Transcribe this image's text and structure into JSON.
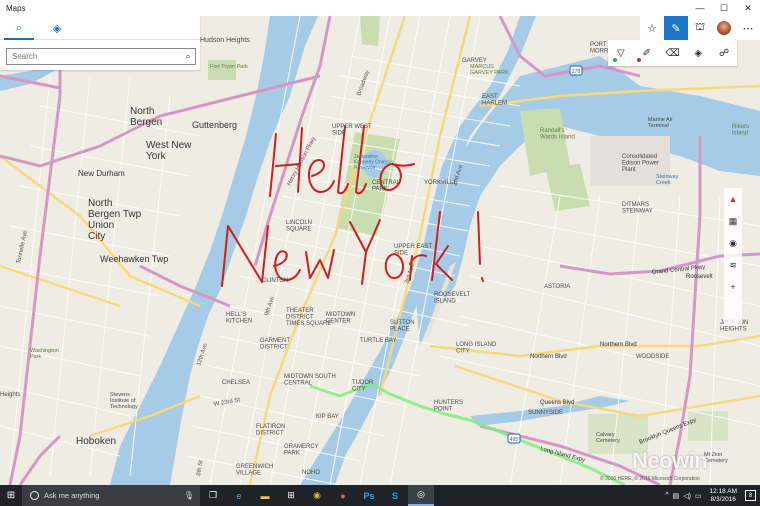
{
  "window": {
    "title": "Maps",
    "controls": [
      "—",
      "☐",
      "✕"
    ]
  },
  "panel": {
    "tabs": [
      {
        "icon": "search-icon",
        "glyph": "⌕"
      },
      {
        "icon": "directions-icon",
        "glyph": "◈"
      }
    ],
    "search_placeholder": "Search"
  },
  "toolbar": {
    "buttons": [
      {
        "name": "favorites-star-icon",
        "glyph": "☆"
      },
      {
        "name": "ink-pen-icon",
        "glyph": "✎"
      },
      {
        "name": "3d-cities-icon",
        "glyph": "⛫"
      },
      {
        "name": "more-icon",
        "glyph": "⋯"
      }
    ]
  },
  "ink": {
    "tools": [
      {
        "name": "ballpoint-pen-icon",
        "glyph": "▽"
      },
      {
        "name": "highlighter-icon",
        "glyph": "✐"
      },
      {
        "name": "eraser-icon",
        "glyph": "⌫"
      },
      {
        "name": "route-icon",
        "glyph": "◈"
      },
      {
        "name": "measure-icon",
        "glyph": "☍"
      }
    ],
    "colors": {
      "pen_green": "#22b14c",
      "pen_red": "#d42a2a",
      "ink_red": "#cc1f1f",
      "route": "#7ef07e"
    },
    "text_line1": "Hello",
    "text_line2": "New York!"
  },
  "map_controls": [
    "compass-icon",
    "3d-view-icon",
    "locate-icon",
    "map-layers-icon",
    "zoom-in-icon"
  ],
  "places": {
    "hudson_heights": "Hudson Heights",
    "fort_tryon": "Fort Tryon Park",
    "garvey": "GARVEY",
    "marcus_garvey": "MARCUS\nGARVEY PARK",
    "north_bergen": "North\nBergen",
    "guttenberg": "Guttenberg",
    "west_new_york": "West New\nYork",
    "new_durham": "New Durham",
    "north_bergen_twp": "North\nBergen Twp\nUnion\nCity",
    "weehawken": "Weehawken Twp",
    "hoboken": "Hoboken",
    "upper_west_side": "UPPER WEST\nSIDE",
    "central_park": "CENTRAL\nPARK",
    "lincoln_square": "LINCOLN\nSQUARE",
    "clinton": "CLINTON",
    "hells_kitchen": "HELL'S\nKITCHEN",
    "theater_district": "THEATER\nDISTRICT\nTIMES SQUARE",
    "midtown_center": "MIDTOWN\nCENTER",
    "garment_district": "GARMENT\nDISTRICT",
    "chelsea": "CHELSEA",
    "midtown_south": "MIDTOWN SOUTH\nCENTRAL",
    "turtle_bay": "TURTLE BAY",
    "sutton_place": "SUTTON\nPLACE",
    "tudor_city": "TUDOR\nCITY",
    "kip_bay": "KIP BAY",
    "flatiron": "FLATIRON\nDISTRICT",
    "gramercy": "GRAMERCY\nPARK",
    "greenwich": "GREENWICH\nVILLAGE",
    "noho": "NOHO",
    "astoria": "ASTORIA",
    "long_island_city": "LONG ISLAND\nCITY",
    "hunters_point": "HUNTERS\nPOINT",
    "sunnyside": "SUNNYSIDE",
    "woodside": "WOODSIDE",
    "ditmars": "DITMARS\nSTEINWAY",
    "east_harlem": "EAST\nHARLEM",
    "upper_east": "UPPER EAST\nSIDE",
    "yorkville": "YORKVILLE",
    "roosevelt_island": "ROOSEVELT\nISLAND",
    "randalls": "Randall's\nWards Island",
    "rikers": "Rikers\nIsland",
    "edison": "Consolidated\nEdison Power\nPlant",
    "jackson_heights": "JACKSON\nHEIGHTS",
    "port_morris": "PORT\nMORRIS",
    "roosevelt_ave": "Roosevelt",
    "steinway_creek": "Steinway\nCreek",
    "jacqueline": "Jacqueline\nKennedy Onassis\nReservoir",
    "marine_plant": "Marine Air\nTerminal",
    "mt_zion": "Mt Zion\nCemetery",
    "calvary": "Calvary\nCemetery",
    "stevens": "Stevens\nInstitute of\nTechnology",
    "washington_park": "Washington\nPark",
    "harlem_heights": "Heights"
  },
  "roads": {
    "henry_hudson": "Henry Hudson Pkwy",
    "broadway": "Broadway",
    "second_ave": "2nd Ave",
    "third_ave": "3rd Ave",
    "ninth_ave": "9th Ave",
    "twelfth_ave": "12th Ave",
    "w23": "W 23rd St",
    "tonnelle": "Tonnelle Ave",
    "grand_central": "Grand Central Pkwy",
    "northern": "Northern Blvd",
    "queens": "Queens Blvd",
    "lie": "Long Island Expy",
    "bqe": "Brooklyn Queens Expy",
    "eighth": "8th St",
    "first_ave": "1st Ave",
    "w_side": "West Side Hwy"
  },
  "shields": [
    "495",
    "278"
  ],
  "copyright": "© 2016 HERE, © 2016 Microsoft Corporation",
  "watermark": "Neowin",
  "taskbar": {
    "search_placeholder": "Ask me anything",
    "apps": [
      {
        "name": "task-view-icon",
        "glyph": "❐"
      },
      {
        "name": "edge-icon",
        "glyph": "e"
      },
      {
        "name": "file-explorer-icon",
        "glyph": "▬"
      },
      {
        "name": "store-icon",
        "glyph": "⊞"
      },
      {
        "name": "chrome-icon",
        "glyph": "◉"
      },
      {
        "name": "firefox-icon",
        "glyph": "●"
      },
      {
        "name": "photoshop-icon",
        "glyph": "Ps"
      },
      {
        "name": "skype-icon",
        "glyph": "S"
      },
      {
        "name": "maps-taskbar-icon",
        "glyph": "◎"
      }
    ],
    "time": "12:18 AM",
    "date": "8/3/2016",
    "notifications": "8"
  }
}
